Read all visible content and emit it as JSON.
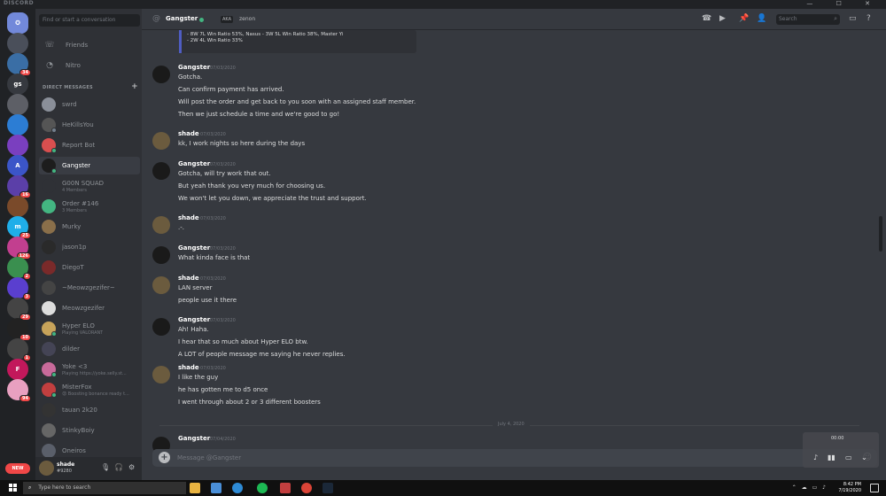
{
  "window": {
    "brand": "DISCORD",
    "controls": "— ☐ ✕"
  },
  "guilds": [
    {
      "name": "home",
      "color": "#7289da",
      "glyph": "✪",
      "badge": ""
    },
    {
      "name": "server-1",
      "color": "#4a4f5a",
      "glyph": "",
      "badge": ""
    },
    {
      "name": "server-2",
      "color": "#3a6ea5",
      "glyph": "",
      "badge": "34"
    },
    {
      "name": "server-gs",
      "color": "#36393f",
      "glyph": "gs",
      "badge": ""
    },
    {
      "name": "server-4",
      "color": "#5d5f66",
      "glyph": "",
      "badge": ""
    },
    {
      "name": "server-5",
      "color": "#2c7dd4",
      "glyph": "",
      "badge": ""
    },
    {
      "name": "server-6",
      "color": "#7a3fbf",
      "glyph": "",
      "badge": ""
    },
    {
      "name": "server-a",
      "color": "#3b55c8",
      "glyph": "A",
      "badge": ""
    },
    {
      "name": "server-8",
      "color": "#5b3fa8",
      "glyph": "",
      "badge": "16"
    },
    {
      "name": "server-9",
      "color": "#7a4a2a",
      "glyph": "",
      "badge": ""
    },
    {
      "name": "server-m",
      "color": "#1faee9",
      "glyph": "m",
      "badge": "25"
    },
    {
      "name": "server-11",
      "color": "#c23f8f",
      "glyph": "",
      "badge": "126"
    },
    {
      "name": "server-12",
      "color": "#3a8f4f",
      "glyph": "",
      "badge": "2"
    },
    {
      "name": "server-13",
      "color": "#5a3fcf",
      "glyph": "",
      "badge": "3"
    },
    {
      "name": "server-14",
      "color": "#444",
      "glyph": "",
      "badge": "29"
    },
    {
      "name": "server-15",
      "color": "#222",
      "glyph": "",
      "badge": "10"
    },
    {
      "name": "server-16",
      "color": "#444",
      "glyph": "",
      "badge": "1"
    },
    {
      "name": "server-f",
      "color": "#c2185b",
      "glyph": "F",
      "badge": ""
    },
    {
      "name": "server-18",
      "color": "#e8a0c0",
      "glyph": "",
      "badge": "94"
    }
  ],
  "new_badge": "NEW",
  "sidebar": {
    "search_placeholder": "Find or start a conversation",
    "friends_label": "Friends",
    "nitro_label": "Nitro",
    "dm_header": "DIRECT MESSAGES",
    "dms": [
      {
        "name": "swrd",
        "sub": "",
        "avatar": "#8a8f99",
        "status": "",
        "active": false
      },
      {
        "name": "HeKillsYou",
        "sub": "",
        "avatar": "#555",
        "status": "#747f8d",
        "active": false
      },
      {
        "name": "Report Bot",
        "sub": "",
        "avatar": "#d94f4f",
        "status": "#43b581",
        "active": false
      },
      {
        "name": "Gangster",
        "sub": "",
        "avatar": "#1d1d1d",
        "status": "#43b581",
        "active": true
      },
      {
        "name": "G00N SQUAD",
        "sub": "4 Members",
        "avatar": "#2f3136",
        "status": "",
        "active": false
      },
      {
        "name": "Order #146",
        "sub": "3 Members",
        "avatar": "#43b581",
        "status": "",
        "active": false
      },
      {
        "name": "Murky",
        "sub": "",
        "avatar": "#8a6f4a",
        "status": "",
        "active": false
      },
      {
        "name": "jason1p",
        "sub": "",
        "avatar": "#2a2a2a",
        "status": "",
        "active": false
      },
      {
        "name": "DiegoT",
        "sub": "",
        "avatar": "#7a2a2a",
        "status": "",
        "active": false
      },
      {
        "name": "~Meowzgezifer~",
        "sub": "",
        "avatar": "#444",
        "status": "",
        "active": false
      },
      {
        "name": "Meowzgezifer",
        "sub": "",
        "avatar": "#ddd",
        "status": "",
        "active": false
      },
      {
        "name": "Hyper ELO",
        "sub": "Playing VALORANT",
        "avatar": "#c7a35a",
        "status": "#43b581",
        "active": false
      },
      {
        "name": "dilder",
        "sub": "",
        "avatar": "#445",
        "status": "",
        "active": false
      },
      {
        "name": "Yoke <3",
        "sub": "Playing https://yoke.selly.st...",
        "avatar": "#c86a9a",
        "status": "#43b581",
        "active": false
      },
      {
        "name": "MisterFox",
        "sub": "😡 Boosting bonance ready t...",
        "avatar": "#c23f3f",
        "status": "#43b581",
        "active": false
      },
      {
        "name": "tauan 2k20",
        "sub": "",
        "avatar": "#333",
        "status": "",
        "active": false
      },
      {
        "name": "StinkyBoiy",
        "sub": "",
        "avatar": "#666",
        "status": "",
        "active": false
      },
      {
        "name": "Oneiros",
        "sub": "",
        "avatar": "#5a5f6a",
        "status": "",
        "active": false
      }
    ]
  },
  "user": {
    "name": "shade",
    "tag": "#9280"
  },
  "header": {
    "title": "Gangster",
    "aka": "AKA",
    "alias": "zenon",
    "search_placeholder": "Search"
  },
  "embed_lines": [
    "- 8W 7L Win Ratio 53%, Nasus - 3W 5L Win Ratio 38%, Master Yi",
    "- 2W 4L Win Ratio 33%"
  ],
  "messages": [
    {
      "author": "Gangster",
      "date": "07/03/2020",
      "avatar": "#1a1a1a",
      "lines": [
        "Gotcha.",
        "Can confirm payment has arrived.",
        "Will post the order and get back to you soon with an assigned staff member.",
        "Then we just schedule a time and we're good to go!"
      ]
    },
    {
      "author": "shade",
      "date": "07/03/2020",
      "avatar": "#6b5b3e",
      "lines": [
        "kk, I work nights so here during the days"
      ]
    },
    {
      "author": "Gangster",
      "date": "07/03/2020",
      "avatar": "#1a1a1a",
      "lines": [
        "Gotcha, will try work that out.",
        "But yeah thank you very much for choosing us.",
        "We won't let you down, we appreciate the trust and support."
      ]
    },
    {
      "author": "shade",
      "date": "07/03/2020",
      "avatar": "#6b5b3e",
      "lines": [
        ".-."
      ]
    },
    {
      "author": "Gangster",
      "date": "07/03/2020",
      "avatar": "#1a1a1a",
      "lines": [
        "What kinda face is that"
      ]
    },
    {
      "author": "shade",
      "date": "07/03/2020",
      "avatar": "#6b5b3e",
      "lines": [
        "LAN server",
        "people use it there"
      ]
    },
    {
      "author": "Gangster",
      "date": "07/03/2020",
      "avatar": "#1a1a1a",
      "lines": [
        "Ah! Haha.",
        "I hear that so much about Hyper ELO btw.",
        "A LOT of people message me saying he never replies."
      ]
    },
    {
      "author": "shade",
      "date": "07/03/2020",
      "avatar": "#6b5b3e",
      "lines": [
        "I like the guy",
        "he has gotten me to d5 once",
        "I went through about 2 or 3 different boosters"
      ]
    },
    {
      "author": "Gangster",
      "date": "07/04/2020",
      "avatar": "#1a1a1a",
      "lines": []
    }
  ],
  "date_divider": "July 4, 2020",
  "composer_placeholder": "Message @Gangster",
  "media_time": "00:00",
  "taskbar": {
    "search_placeholder": "Type here to search",
    "time": "8:42 PM",
    "date": "7/19/2020"
  }
}
